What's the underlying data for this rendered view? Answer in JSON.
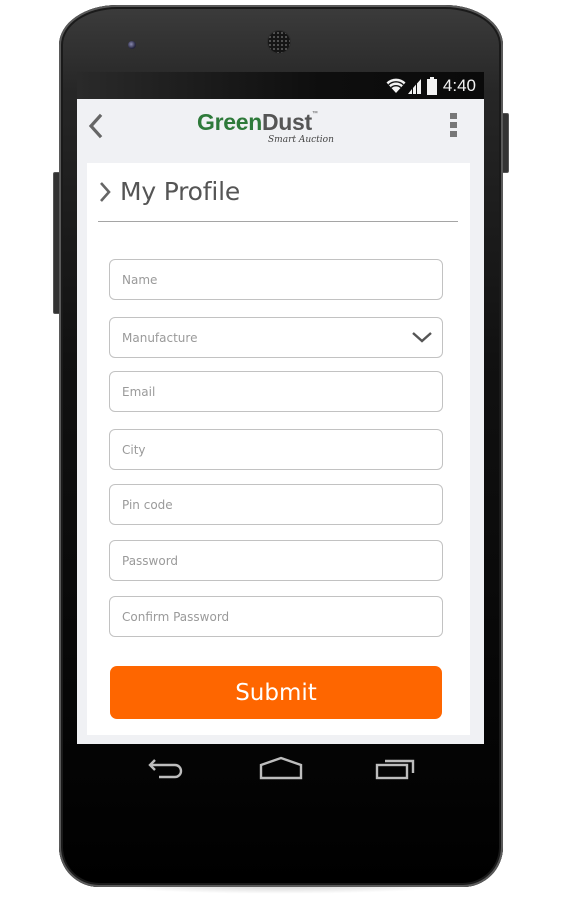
{
  "device": {
    "status_bar": {
      "time": "4:40",
      "icons": [
        "wifi-icon",
        "signal-icon",
        "battery-icon"
      ]
    },
    "nav_bar": {
      "buttons": [
        {
          "name": "back",
          "icon": "back-arrow-icon"
        },
        {
          "name": "home",
          "icon": "home-icon"
        },
        {
          "name": "recents",
          "icon": "recent-apps-icon"
        }
      ]
    }
  },
  "app_bar": {
    "back_icon": "chevron-left-icon",
    "logo": {
      "brand_green": "Green",
      "brand_gray": "Dust",
      "trademark": "™",
      "tagline": "Smart Auction"
    },
    "menu_icon": "more-vertical-icon"
  },
  "page": {
    "title": "My Profile",
    "title_icon": "chevron-right-icon"
  },
  "form": {
    "fields": [
      {
        "name": "name",
        "placeholder": "Name",
        "value": "",
        "type": "text"
      },
      {
        "name": "manufacture",
        "placeholder": "Manufacture",
        "value": "",
        "type": "select"
      },
      {
        "name": "email",
        "placeholder": "Email",
        "value": "",
        "type": "email"
      },
      {
        "name": "city",
        "placeholder": "City",
        "value": "",
        "type": "text"
      },
      {
        "name": "pin-code",
        "placeholder": "Pin code",
        "value": "",
        "type": "text"
      },
      {
        "name": "password",
        "placeholder": "Password",
        "value": "",
        "type": "password"
      },
      {
        "name": "confirm-password",
        "placeholder": "Confirm Password",
        "value": "",
        "type": "password"
      }
    ],
    "submit_label": "Submit"
  },
  "colors": {
    "brand_green": "#2e7a3a",
    "accent_orange": "#fe6600",
    "screen_background": "#f0f1f4",
    "field_border": "#c2c2c2"
  }
}
